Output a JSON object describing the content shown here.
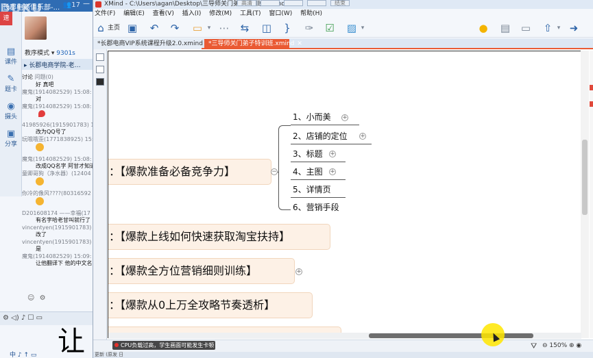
{
  "chat": {
    "title": "长郡电商俱乐部-...",
    "count": "17",
    "side_buttons": [
      {
        "icon": "video-icon",
        "label": "速"
      },
      {
        "icon": "courseware-icon",
        "label": "课件"
      },
      {
        "icon": "pen-icon",
        "label": "题卡"
      },
      {
        "icon": "camera-icon",
        "label": "摄头"
      },
      {
        "icon": "share-icon",
        "label": "分享"
      }
    ],
    "mode_label": "教序模式",
    "mode_value": "9301s",
    "class_name": "长郡电商学院-老…",
    "discuss_label": "讨论",
    "question_label": "问题(0)",
    "messages": [
      {
        "who": "",
        "text": "好 真吧"
      },
      {
        "who": "魔鬼(1914082529) 15:08:",
        "text": "对"
      },
      {
        "who": "魔鬼(1914082529) 15:08:",
        "text": ""
      },
      {
        "who": "41985926(1915901783) 15:",
        "text": "改为QQ号了"
      },
      {
        "who": "玩哦哦歪(1771838925) 15:",
        "text": ""
      },
      {
        "who": "魔鬼(1914082529) 15:08:",
        "text": "改成QQ名字 阿甘才知道"
      },
      {
        "who": "童卿哥狗（净水器）(12404",
        "text": ""
      },
      {
        "who": "你冷的像风????(80316592",
        "text": ""
      },
      {
        "who": "D201608174 ——幸福(17",
        "text": "有名字哈老甘叫就行了"
      },
      {
        "who": "vincentyen(1915901783)",
        "text": "改了"
      },
      {
        "who": "vincentyen(1915901783)",
        "text": "是"
      },
      {
        "who": "魔鬼(1914082529) 15:09:",
        "text": "让他翻译下 他的中文名"
      }
    ],
    "input_hint": "",
    "bottom_icons": "⚙ ◁) ♪ ☐ ▭",
    "big_char": "让",
    "tray_text": "中 ♪ ↑ ▭"
  },
  "window": {
    "title": "XMind - C:\\Users\\agan\\Desktop\\三导师关门弟子特训班.xmind",
    "btns": [
      "高清",
      "",
      "",
      "",
      "结束"
    ]
  },
  "menu": [
    "文件(F)",
    "编辑(E)",
    "查看(V)",
    "插入(I)",
    "修改(M)",
    "工具(T)",
    "窗口(W)",
    "帮助(H)"
  ],
  "toolbar": {
    "home_label": "主页"
  },
  "tabs": [
    {
      "label": "*长郡电商VIP系统课程升级2.0.xmind",
      "active": false
    },
    {
      "label": "*三导师关门弟子特训班.xmind",
      "active": true
    }
  ],
  "topics": [
    {
      "label": "：【爆款准备必备竞争力】"
    },
    {
      "label": "：【爆款上线如何快速获取淘宝扶持】"
    },
    {
      "label": "：【爆款全方位营销细则训练】"
    },
    {
      "label": "：【爆款从0上万全攻略节奏透析】"
    }
  ],
  "subtopics": [
    {
      "label": "1、小而美",
      "expandable": true
    },
    {
      "label": "2、店铺的定位",
      "expandable": true
    },
    {
      "label": "3、标题",
      "expandable": true
    },
    {
      "label": "4、主图",
      "expandable": true
    },
    {
      "label": "5、详情页",
      "expandable": false
    },
    {
      "label": "6、营销手段",
      "expandable": false
    }
  ],
  "status": {
    "notification": "CPU负载过高，学生画面可能发生卡顿",
    "zoom": "150%",
    "bottom_text": "更新 (原发 日"
  },
  "colors": {
    "accent": "#ea5a33",
    "topic_fill": "#fdf1e6",
    "chat_title": "#2f6cb3"
  }
}
